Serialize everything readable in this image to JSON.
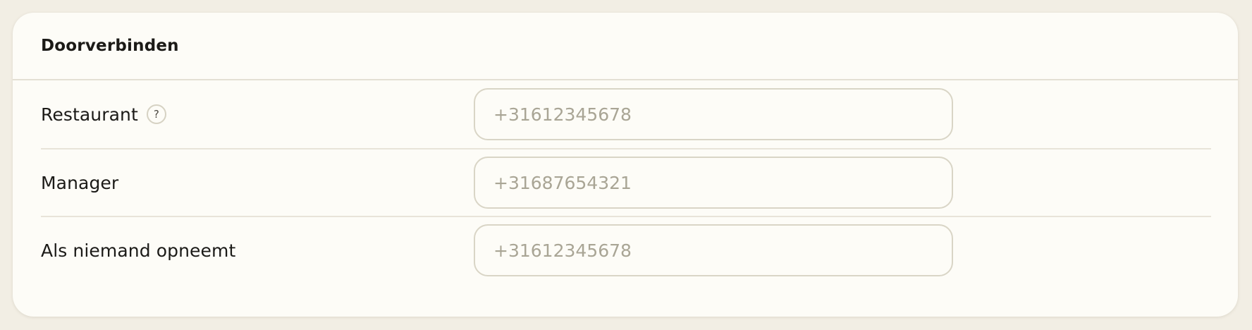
{
  "section": {
    "title": "Doorverbinden"
  },
  "rows": [
    {
      "label": "Restaurant",
      "has_help": true,
      "help_glyph": "?",
      "value": "",
      "placeholder": "+31612345678"
    },
    {
      "label": "Manager",
      "has_help": false,
      "value": "",
      "placeholder": "+31687654321"
    },
    {
      "label": "Als niemand opneemt",
      "has_help": false,
      "value": "",
      "placeholder": "+31612345678"
    }
  ],
  "icons": {
    "help": "question-mark-circle-icon"
  },
  "colors": {
    "page_background": "#f2eee4",
    "card_background": "#fdfcf7",
    "divider": "#e4e0d4",
    "input_border": "#d9d5c6",
    "placeholder_text": "#a9a595",
    "text": "#1b1a17"
  }
}
